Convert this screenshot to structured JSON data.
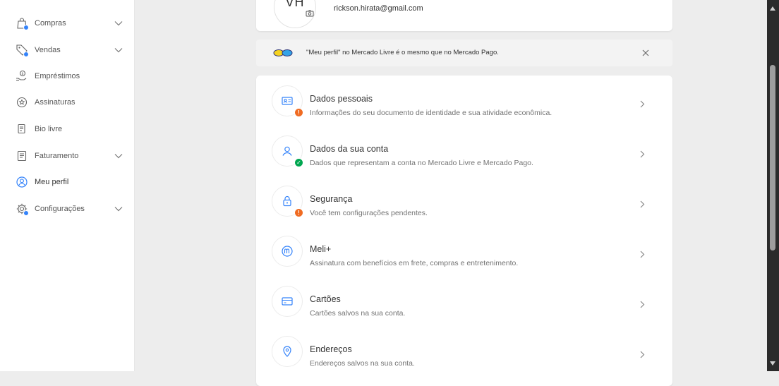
{
  "sidebar": {
    "items": [
      {
        "label": "Compras",
        "icon": "shopping-bag-icon",
        "expandable": true
      },
      {
        "label": "Vendas",
        "icon": "tag-icon",
        "expandable": true
      },
      {
        "label": "Empréstimos",
        "icon": "loan-icon",
        "expandable": false
      },
      {
        "label": "Assinaturas",
        "icon": "star-badge-icon",
        "expandable": false
      },
      {
        "label": "Bio livre",
        "icon": "document-icon",
        "expandable": false
      },
      {
        "label": "Faturamento",
        "icon": "receipt-icon",
        "expandable": true
      },
      {
        "label": "Meu perfil",
        "icon": "user-circle-icon",
        "expandable": false,
        "active": true
      },
      {
        "label": "Configurações",
        "icon": "gear-icon",
        "expandable": true
      }
    ]
  },
  "profile": {
    "initials": "VH",
    "email": "rickson.hirata@gmail.com"
  },
  "banner": {
    "text": "\"Meu perfil\" no Mercado Livre é o mesmo que no Mercado Pago."
  },
  "menu": [
    {
      "title": "Dados pessoais",
      "desc": "Informações do seu documento de identidade e sua atividade econômica.",
      "icon": "id-card-icon",
      "badge": "warning"
    },
    {
      "title": "Dados da sua conta",
      "desc": "Dados que representam a conta no Mercado Livre e Mercado Pago.",
      "icon": "user-icon",
      "badge": "ok"
    },
    {
      "title": "Segurança",
      "desc": "Você tem configurações pendentes.",
      "icon": "lock-icon",
      "badge": "warning"
    },
    {
      "title": "Meli+",
      "desc": "Assinatura com benefícios em frete, compras e entretenimento.",
      "icon": "meli-plus-icon",
      "badge": "none"
    },
    {
      "title": "Cartões",
      "desc": "Cartões salvos na sua conta.",
      "icon": "card-icon",
      "badge": "none"
    },
    {
      "title": "Endereços",
      "desc": "Endereços salvos na sua conta.",
      "icon": "location-pin-icon",
      "badge": "none"
    }
  ],
  "colors": {
    "accent": "#3483fa",
    "warning": "#f06b22",
    "ok": "#00a650"
  }
}
